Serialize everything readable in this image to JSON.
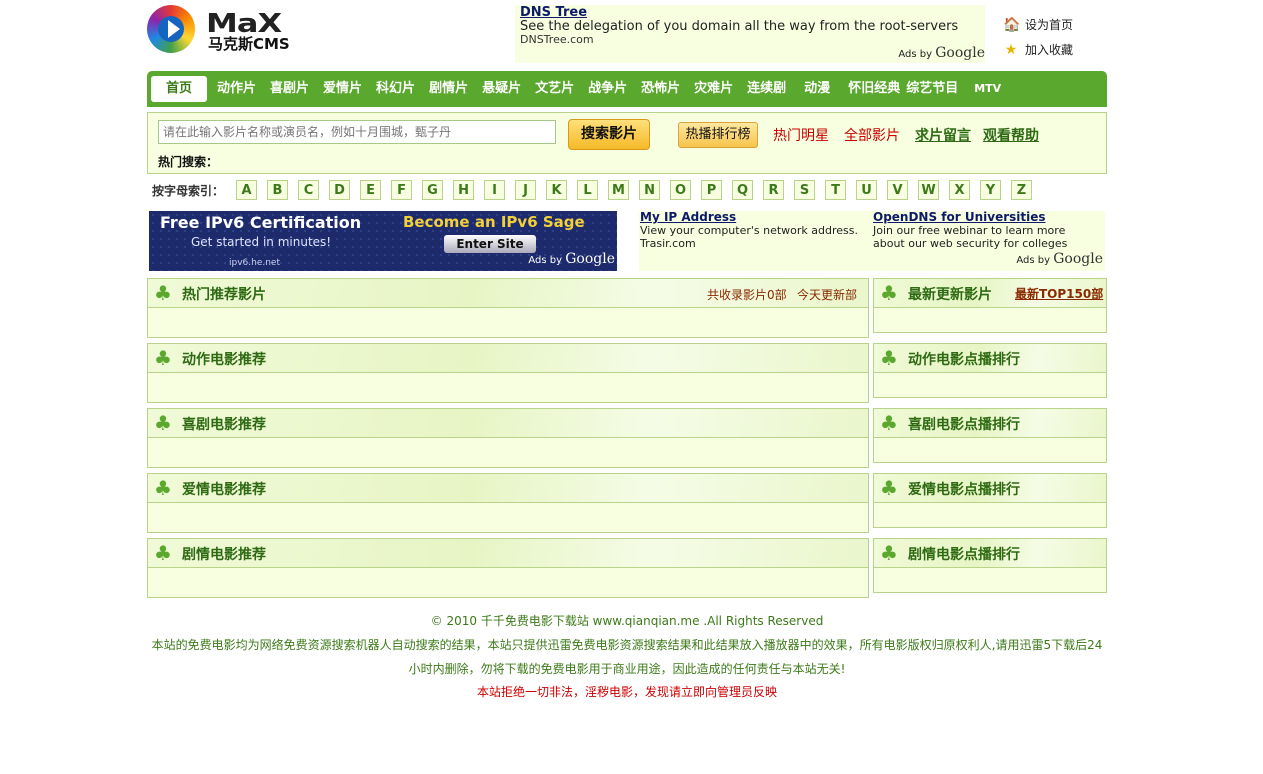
{
  "logo": {
    "text": "MaX",
    "subtitle": "马克斯CMS"
  },
  "top_ad": {
    "title": "DNS Tree",
    "desc": "See the delegation of you domain all the way from the root-servers",
    "url": "DNSTree.com",
    "ads_by": "Ads by",
    "google": "Google"
  },
  "header_links": [
    {
      "label": "设为首页",
      "icon": "home-icon"
    },
    {
      "label": "加入收藏",
      "icon": "star-icon"
    }
  ],
  "nav": [
    "首页",
    "动作片",
    "喜剧片",
    "爱情片",
    "科幻片",
    "剧情片",
    "悬疑片",
    "文艺片",
    "战争片",
    "恐怖片",
    "灾难片",
    "连续剧",
    "动漫",
    "怀旧经典",
    "综艺节目",
    "MTV"
  ],
  "search": {
    "placeholder": "请在此输入影片名称或演员名，例如十月围城，甄子丹",
    "button": "搜索影片",
    "rank": "热播排行榜",
    "hot_stars": "热门明星",
    "all_movies": "全部影片",
    "request": "求片留言",
    "help": "观看帮助",
    "hot_label": "热门搜索："
  },
  "letter_index": {
    "label": "按字母索引：",
    "letters": [
      "A",
      "B",
      "C",
      "D",
      "E",
      "F",
      "G",
      "H",
      "I",
      "J",
      "K",
      "L",
      "M",
      "N",
      "O",
      "P",
      "Q",
      "R",
      "S",
      "T",
      "U",
      "V",
      "W",
      "X",
      "Y",
      "Z"
    ]
  },
  "ipv6_ad": {
    "title": "Free IPv6 Certification",
    "sub": "Get started in minutes!",
    "sage": "Become an IPv6 Sage",
    "enter": "Enter Site",
    "url": "ipv6.he.net",
    "ads_by": "Ads by",
    "google": "Google"
  },
  "ad2": {
    "left_title": "My IP Address",
    "left_desc": "View your computer's network address.",
    "left_url": "Trasir.com",
    "right_title": "OpenDNS for Universities",
    "right_desc": "Join our free webinar to learn more about our web security for colleges",
    "ads_by": "Ads by",
    "google": "Google"
  },
  "main_panels": [
    {
      "title": "热门推荐影片",
      "meta1": "共收录影片0部",
      "meta2": "今天更新部"
    },
    {
      "title": "动作电影推荐"
    },
    {
      "title": "喜剧电影推荐"
    },
    {
      "title": "爱情电影推荐"
    },
    {
      "title": "剧情电影推荐"
    }
  ],
  "side_panels": [
    {
      "title": "最新更新影片",
      "link": "最新TOP150部"
    },
    {
      "title": "动作电影点播排行"
    },
    {
      "title": "喜剧电影点播排行"
    },
    {
      "title": "爱情电影点播排行"
    },
    {
      "title": "剧情电影点播排行"
    }
  ],
  "footer": {
    "copyright": "© 2010 千千免费电影下载站 www.qianqian.me .All Rights Reserved",
    "disclaimer1": "本站的免费电影均为网络免费资源搜索机器人自动搜索的结果，本站只提供迅雷免费电影资源搜索结果和此结果放入播放器中的效果，所有电影版权归原权利人,请用迅雷5下载后24",
    "disclaimer2": "小时内删除，勿将下载的免费电影用于商业用途，因此造成的任何责任与本站无关!",
    "warning": "本站拒绝一切非法，淫秽电影，发现请立即向管理员反映"
  },
  "colors": {
    "green": "#5aa82d",
    "panel_bg": "#f7ffe0",
    "border": "#b9d38a",
    "title": "#2d6a12"
  }
}
